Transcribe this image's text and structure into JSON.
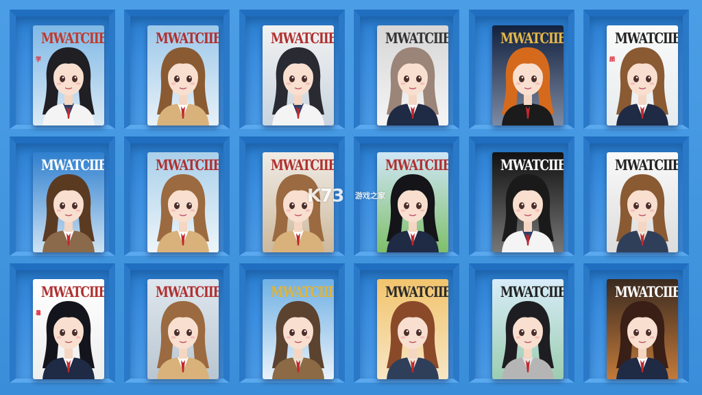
{
  "shelf": {
    "background": "#3f95e1",
    "cards": [
      {
        "title": "MWATCIIED",
        "bg": [
          "#7fb8e6",
          "#dbeaf5"
        ],
        "title_color": "#c0392b",
        "frame": "#d95c3c",
        "hair": "#1f1f24",
        "outfit": "white-shirt",
        "kanji": "学"
      },
      {
        "title": "MWATCIIED",
        "bg": [
          "#9cc8ea",
          "#e8f1f8"
        ],
        "title_color": "#b03030",
        "frame": "",
        "hair": "#8a5a33",
        "outfit": "beige-jacket",
        "kanji": ""
      },
      {
        "title": "MWATCIIED",
        "bg": [
          "#f2f2f2",
          "#c8d4df"
        ],
        "title_color": "#b03030",
        "frame": "",
        "hair": "#2a2a33",
        "outfit": "white-shirt",
        "kanji": ""
      },
      {
        "title": "MWATCIIED",
        "bg": [
          "#d6d6d6",
          "#f5f5f5"
        ],
        "title_color": "#333333",
        "frame": "",
        "hair": "#9b8478",
        "outfit": "navy-blazer",
        "kanji": ""
      },
      {
        "title": "MWATCIIED",
        "bg": [
          "#12213e",
          "#7d8aa3"
        ],
        "title_color": "#e6b84a",
        "frame": "",
        "hair": "#d66a1c",
        "outfit": "black-tee",
        "kanji": ""
      },
      {
        "title": "MWATCIIED",
        "bg": [
          "#fafafa",
          "#e6ecee"
        ],
        "title_color": "#222222",
        "frame": "",
        "hair": "#8a5a33",
        "outfit": "navy-blazer",
        "kanji": "顔"
      },
      {
        "title": "MWATCIIED",
        "bg": [
          "#2e7fcf",
          "#cfe3f3"
        ],
        "title_color": "#ffffff",
        "frame": "",
        "hair": "#5b3a22",
        "outfit": "brown-blazer",
        "kanji": ""
      },
      {
        "title": "MWATCIIED",
        "bg": [
          "#a9d0ea",
          "#eef5fa"
        ],
        "title_color": "#b03030",
        "frame": "",
        "hair": "#9b6a40",
        "outfit": "beige-jacket",
        "kanji": ""
      },
      {
        "title": "MWATCIIED",
        "bg": [
          "#f0ece6",
          "#cdb89c"
        ],
        "title_color": "#b03030",
        "frame": "",
        "hair": "#9b6a40",
        "outfit": "beige-jacket",
        "kanji": ""
      },
      {
        "title": "MWATCIIED",
        "bg": [
          "#cfe6f7",
          "#7fbf6a"
        ],
        "title_color": "#b03030",
        "frame": "",
        "hair": "#141419",
        "outfit": "navy-blazer",
        "kanji": ""
      },
      {
        "title": "MWATCIIED",
        "bg": [
          "#111111",
          "#777777"
        ],
        "title_color": "#ffffff",
        "frame": "",
        "hair": "#1a1a1a",
        "outfit": "white-shirt",
        "kanji": ""
      },
      {
        "title": "MWATCIIED",
        "bg": [
          "#fafafa",
          "#dcdcdc"
        ],
        "title_color": "#222222",
        "frame": "",
        "hair": "#8a5a33",
        "outfit": "denim",
        "kanji": ""
      },
      {
        "title": "MWATCIIED",
        "bg": [
          "#ffffff",
          "#eeeeee"
        ],
        "title_color": "#b03030",
        "frame": "",
        "hair": "#14141c",
        "outfit": "navy-blazer",
        "kanji": "暑"
      },
      {
        "title": "MWATCIIED",
        "bg": [
          "#dfe7ee",
          "#b9c6d1"
        ],
        "title_color": "#b03030",
        "frame": "",
        "hair": "#9b6a40",
        "outfit": "beige-jacket",
        "kanji": ""
      },
      {
        "title": "MWATCIIED",
        "bg": [
          "#6fb0e4",
          "#e9f2fa"
        ],
        "title_color": "#e0b43a",
        "frame": "",
        "hair": "#5b4330",
        "outfit": "brown-jacket",
        "kanji": ""
      },
      {
        "title": "MWATCIIED",
        "bg": [
          "#f2c46d",
          "#f7e6c4"
        ],
        "title_color": "#2a2a2a",
        "frame": "",
        "hair": "#8a4a2a",
        "outfit": "denim",
        "kanji": ""
      },
      {
        "title": "MWATCIIED",
        "bg": [
          "#d8ecf9",
          "#9ccdb1"
        ],
        "title_color": "#222222",
        "frame": "",
        "hair": "#1e1e22",
        "outfit": "grey-jacket",
        "kanji": ""
      },
      {
        "title": "MWATCIIED",
        "bg": [
          "#3a2a20",
          "#c27a3a"
        ],
        "title_color": "#ffffff",
        "frame": "",
        "hair": "#3a1f16",
        "outfit": "navy-blazer",
        "kanji": ""
      }
    ]
  },
  "watermark": {
    "logo": "K73",
    "subtitle": "游戏之家"
  }
}
